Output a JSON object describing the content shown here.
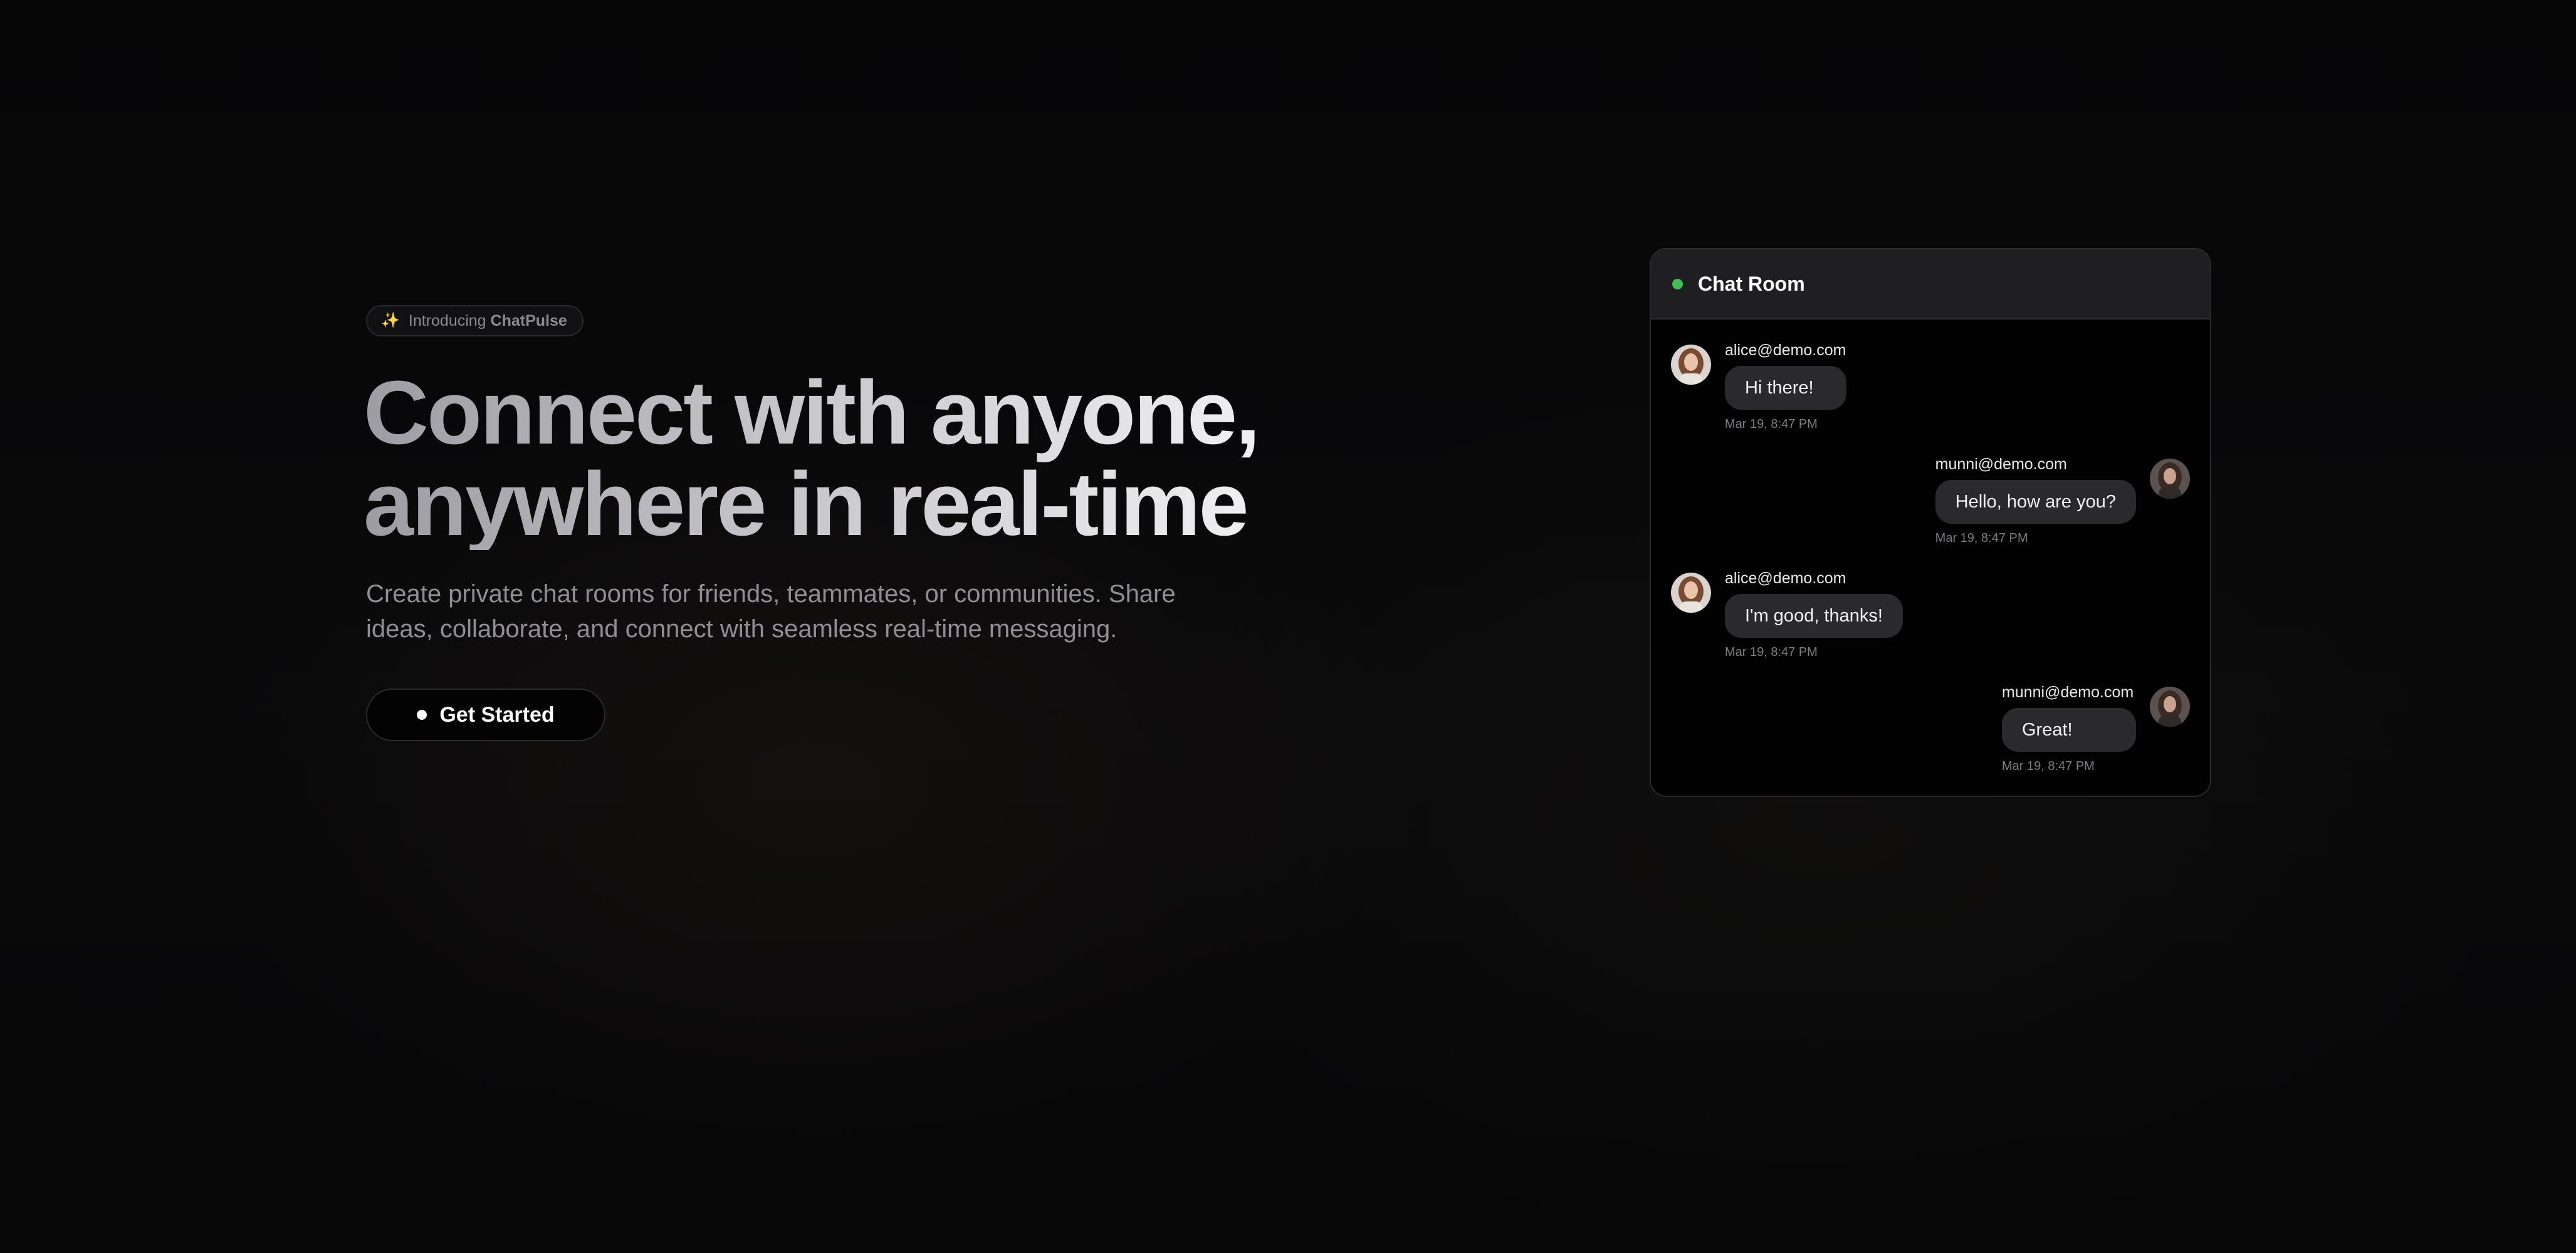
{
  "badge": {
    "icon": "sparkle-icon",
    "prefix": "Introducing",
    "brand": "ChatPulse"
  },
  "hero": {
    "headline_line1": "Connect with anyone,",
    "headline_line2": "anywhere in real-time",
    "subtext_line1": "Create private chat rooms for friends, teammates, or communities. Share",
    "subtext_line2": "ideas, collaborate, and connect with seamless real-time messaging.",
    "cta_label": "Get Started"
  },
  "chat": {
    "title": "Chat Room",
    "status_color": "#3fbf55",
    "messages": [
      {
        "sender": "alice@demo.com",
        "text": "Hi there!",
        "time": "Mar 19, 8:47 PM",
        "side": "left"
      },
      {
        "sender": "munni@demo.com",
        "text": "Hello, how are you?",
        "time": "Mar 19, 8:47 PM",
        "side": "right"
      },
      {
        "sender": "alice@demo.com",
        "text": "I'm good, thanks!",
        "time": "Mar 19, 8:47 PM",
        "side": "left"
      },
      {
        "sender": "munni@demo.com",
        "text": "Great!",
        "time": "Mar 19, 8:47 PM",
        "side": "right"
      }
    ]
  }
}
